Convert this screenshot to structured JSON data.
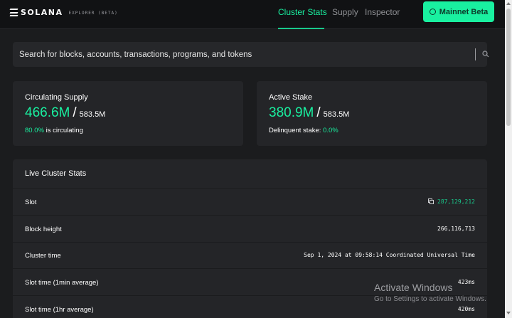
{
  "header": {
    "brand": "SOLANA",
    "brand_sub": "EXPLORER (BETA)",
    "nav": [
      "Cluster Stats",
      "Supply",
      "Inspector"
    ],
    "active_nav": "Cluster Stats",
    "cluster_button": "Mainnet Beta"
  },
  "search": {
    "placeholder": "Search for blocks, accounts, transactions, programs, and tokens"
  },
  "supply": {
    "title": "Circulating Supply",
    "value": "466.6M",
    "total": "583.5M",
    "percent": "80.0%",
    "percent_suffix": "is circulating"
  },
  "stake": {
    "title": "Active Stake",
    "value": "380.9M",
    "total": "583.5M",
    "delinquent_label": "Delinquent stake:",
    "delinquent_value": "0.0%"
  },
  "live": {
    "title": "Live Cluster Stats",
    "rows": [
      {
        "label": "Slot",
        "value": "287,129,212"
      },
      {
        "label": "Block height",
        "value": "266,116,713"
      },
      {
        "label": "Cluster time",
        "value": "Sep 1, 2024 at 09:58:14 Coordinated Universal Time"
      },
      {
        "label": "Slot time (1min average)",
        "value": "423ms"
      },
      {
        "label": "Slot time (1hr average)",
        "value": "420ms"
      }
    ]
  },
  "watermark": {
    "title": "Activate Windows",
    "subtitle": "Go to Settings to activate Windows."
  },
  "colors": {
    "accent": "#19f0a0",
    "background": "#1b1c1e",
    "card": "#242528",
    "topbar": "#111214"
  },
  "icons": [
    "solana-logo-icon",
    "check-circle-icon",
    "search-icon",
    "copy-icon"
  ]
}
